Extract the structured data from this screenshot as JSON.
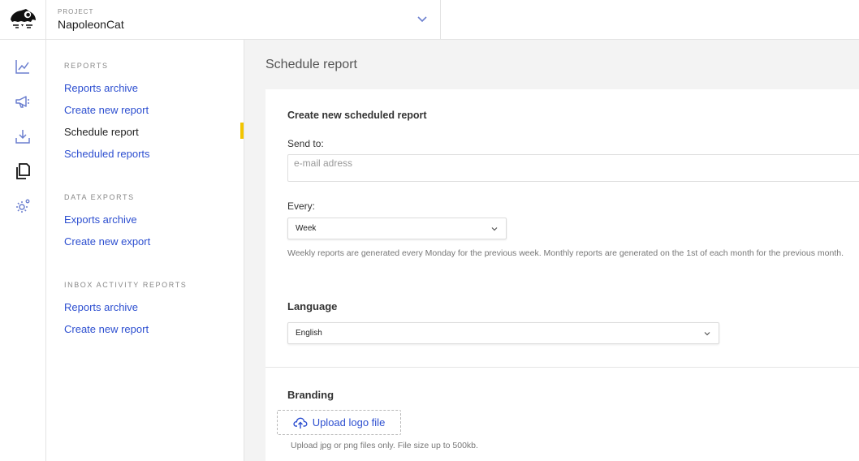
{
  "topbar": {
    "project_label": "PROJECT",
    "project_name": "NapoleonCat",
    "logo_icon": "napoleoncat-logo-icon",
    "chevron_icon": "chevron-down-icon"
  },
  "rail": {
    "items": [
      {
        "icon": "analytics-chart-icon"
      },
      {
        "icon": "megaphone-icon"
      },
      {
        "icon": "download-tray-icon"
      },
      {
        "icon": "documents-icon"
      },
      {
        "icon": "settings-gear-icon"
      }
    ]
  },
  "subnav": {
    "sections": [
      {
        "title": "REPORTS",
        "items": [
          "Reports archive",
          "Create new report",
          "Schedule report",
          "Scheduled reports"
        ]
      },
      {
        "title": "DATA EXPORTS",
        "items": [
          "Exports archive",
          "Create new export"
        ]
      },
      {
        "title": "INBOX ACTIVITY REPORTS",
        "items": [
          "Reports archive",
          "Create new report"
        ]
      }
    ],
    "active_item": "Schedule report"
  },
  "main": {
    "page_title": "Schedule report",
    "form": {
      "heading": "Create new scheduled report",
      "send_to_label": "Send to:",
      "email_placeholder": "e-mail adress",
      "every_label": "Every:",
      "every_value": "Week",
      "every_hint": "Weekly reports are generated every Monday for the previous week. Monthly reports are generated on the 1st of each month for the previous month.",
      "language_label": "Language",
      "language_value": "English",
      "branding_label": "Branding",
      "upload_label": "Upload logo file",
      "upload_hint": "Upload jpg or png files only. File size up to 500kb."
    }
  },
  "colors": {
    "accent": "#2d4fd0",
    "active_marker": "#f2c500",
    "rail_icon": "#6b7fcf"
  }
}
